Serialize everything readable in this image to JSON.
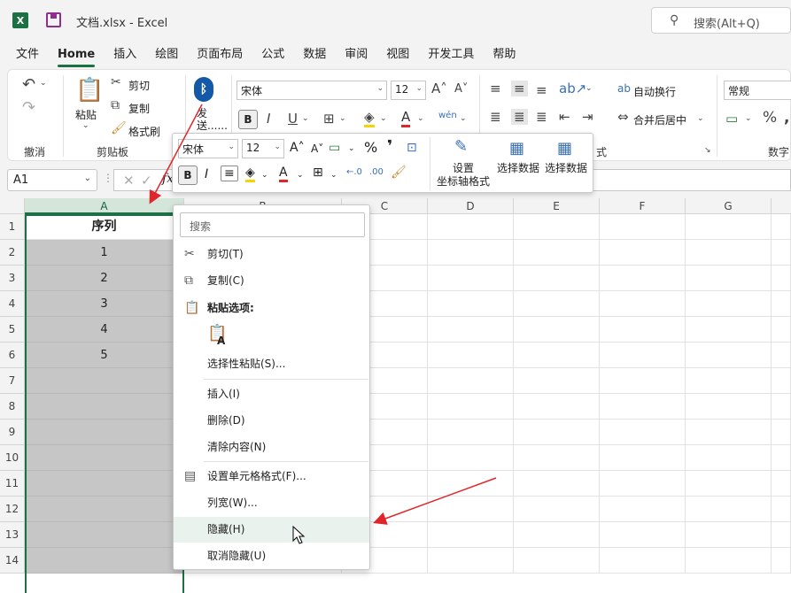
{
  "titlebar": {
    "app_logo": "X",
    "doc_title": "文档.xlsx  -  Excel",
    "search_placeholder": "搜索(Alt+Q)"
  },
  "tabs": [
    "文件",
    "Home",
    "插入",
    "绘图",
    "页面布局",
    "公式",
    "数据",
    "审阅",
    "视图",
    "开发工具",
    "帮助"
  ],
  "active_tab": "Home",
  "ribbon": {
    "undo_label": "撤消",
    "clipboard": {
      "paste": "粘贴",
      "cut": "剪切",
      "copy": "复制",
      "format_painter": "格式刷",
      "group_label": "剪贴板"
    },
    "send": "发送......",
    "font": {
      "name": "宋体",
      "size": "12"
    },
    "alignment": {
      "wrap_text": "自动换行",
      "merge_center": "合并后居中"
    },
    "number": {
      "format": "常规",
      "group_label": "数字"
    },
    "partial_label": "式"
  },
  "formula_bar": {
    "name_box": "A1",
    "fx": "fx"
  },
  "grid": {
    "columns": [
      "A",
      "B",
      "C",
      "D",
      "E",
      "F",
      "G"
    ],
    "rows": [
      "1",
      "2",
      "3",
      "4",
      "5",
      "6",
      "7",
      "8",
      "9",
      "10",
      "11",
      "12",
      "13",
      "14"
    ],
    "a_values": [
      "序列",
      "1",
      "2",
      "3",
      "4",
      "5"
    ]
  },
  "minibar": {
    "font_name": "宋体",
    "font_size": "12",
    "percent": "%",
    "comma": "❜",
    "axis_format_line1": "设置",
    "axis_format_line2": "坐标轴格式",
    "select_data_1": "选择数据",
    "select_data_2": "选择数据"
  },
  "context_menu": {
    "search_placeholder": "搜索",
    "items": {
      "cut": "剪切(T)",
      "copy": "复制(C)",
      "paste_options": "粘贴选项:",
      "paste_special": "选择性粘贴(S)...",
      "insert": "插入(I)",
      "delete": "删除(D)",
      "clear": "清除内容(N)",
      "format_cells": "设置单元格格式(F)...",
      "col_width": "列宽(W)...",
      "hide": "隐藏(H)",
      "unhide": "取消隐藏(U)"
    }
  },
  "colors": {
    "excel_green": "#1d7044",
    "arrow_red": "#e0262a",
    "selection_gray": "#c6c6c6"
  }
}
